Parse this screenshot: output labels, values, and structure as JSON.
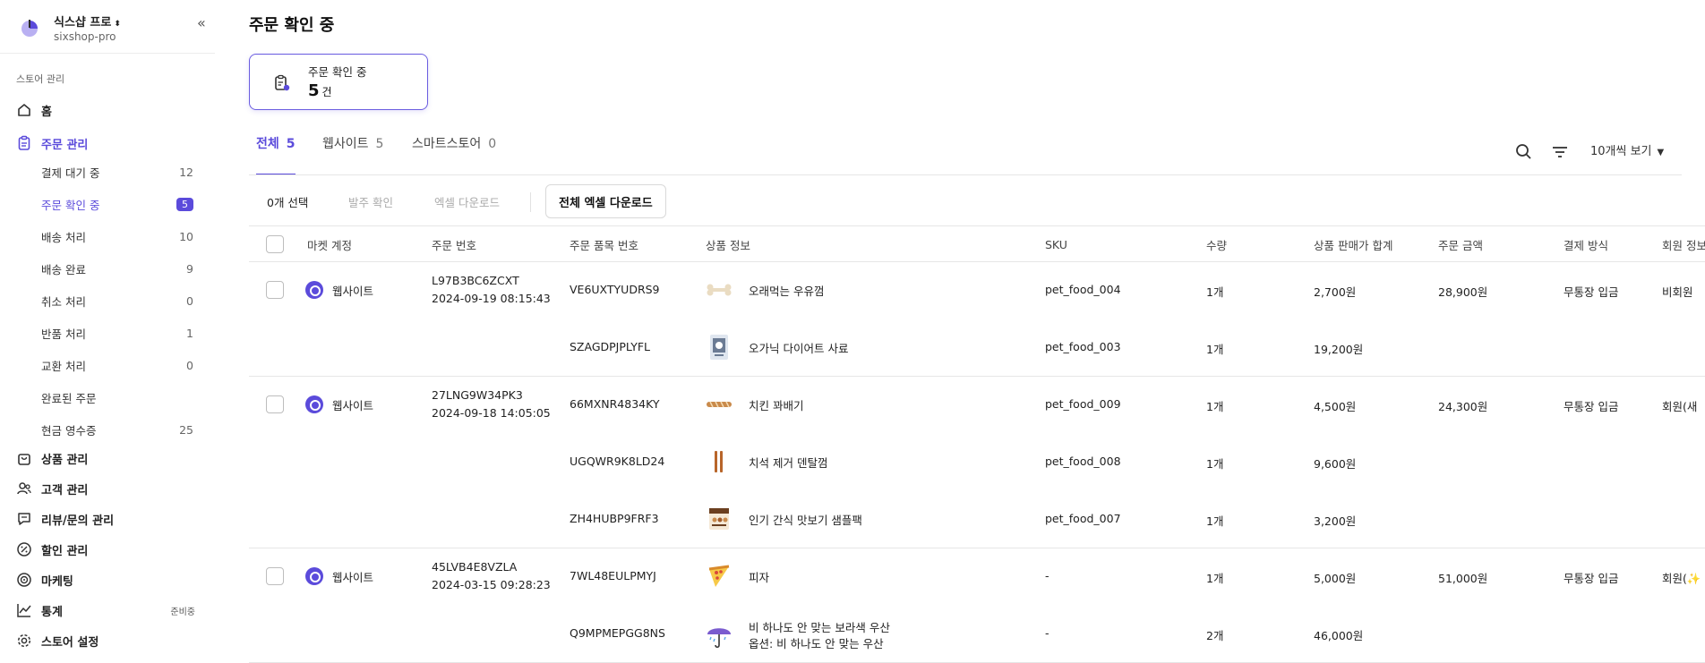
{
  "sidebar": {
    "store_name": "식스샵 프로",
    "store_id": "sixshop-pro",
    "section_title": "스토어 관리",
    "nav": {
      "home": "홈",
      "orders": "주문 관리",
      "products": "상품 관리",
      "customers": "고객 관리",
      "reviews": "리뷰/문의 관리",
      "discounts": "할인 관리",
      "marketing": "마케팅",
      "stats": "통계",
      "stats_badge": "준비중",
      "settings": "스토어 설정"
    },
    "order_sub": [
      {
        "label": "결제 대기 중",
        "count": "12"
      },
      {
        "label": "주문 확인 중",
        "count": "5"
      },
      {
        "label": "배송 처리",
        "count": "10"
      },
      {
        "label": "배송 완료",
        "count": "9"
      },
      {
        "label": "취소 처리",
        "count": "0"
      },
      {
        "label": "반품 처리",
        "count": "1"
      },
      {
        "label": "교환 처리",
        "count": "0"
      },
      {
        "label": "완료된 주문",
        "count": ""
      },
      {
        "label": "현금 영수증",
        "count": "25"
      }
    ]
  },
  "main": {
    "title": "주문 확인 중",
    "summary": {
      "label": "주문 확인 중",
      "value": "5",
      "unit": "건"
    },
    "tabs": [
      {
        "label": "전체",
        "count": "5"
      },
      {
        "label": "웹사이트",
        "count": "5"
      },
      {
        "label": "스마트스토어",
        "count": "0"
      }
    ],
    "view_select": "10개씩 보기",
    "actions": {
      "selected": "0개 선택",
      "confirm": "발주 확인",
      "excel": "엑셀 다운로드",
      "excel_all": "전체 엑셀 다운로드"
    },
    "columns": {
      "market": "마켓 계정",
      "order_no": "주문 번호",
      "item_no": "주문 품목 번호",
      "product": "상품 정보",
      "sku": "SKU",
      "qty": "수량",
      "subtotal": "상품 판매가 합계",
      "amount": "주문 금액",
      "payment": "결제 방식",
      "member": "회원 정보"
    },
    "orders": [
      {
        "market": "웹사이트",
        "order_no": "L97B3BC6ZCXT",
        "date": "2024-09-19 08:15:43",
        "amount": "28,900원",
        "payment": "무통장 입금",
        "member": "비회원",
        "items": [
          {
            "item_no": "VE6UXTYUDRS9",
            "name": "오래먹는 우유껌",
            "sku": "pet_food_004",
            "qty": "1개",
            "subtotal": "2,700원",
            "thumb": "bone-icon"
          },
          {
            "item_no": "SZAGDPJPLYFL",
            "name": "오가닉 다이어트 사료",
            "sku": "pet_food_003",
            "qty": "1개",
            "subtotal": "19,200원",
            "thumb": "food-bag-icon"
          }
        ]
      },
      {
        "market": "웹사이트",
        "order_no": "27LNG9W34PK3",
        "date": "2024-09-18 14:05:05",
        "amount": "24,300원",
        "payment": "무통장 입금",
        "member": "회원(새",
        "items": [
          {
            "item_no": "66MXNR4834KY",
            "name": "치킨 꽈배기",
            "sku": "pet_food_009",
            "qty": "1개",
            "subtotal": "4,500원",
            "thumb": "twist-snack-icon"
          },
          {
            "item_no": "UGQWR9K8LD24",
            "name": "치석 제거 덴탈껌",
            "sku": "pet_food_008",
            "qty": "1개",
            "subtotal": "9,600원",
            "thumb": "dental-stick-icon"
          },
          {
            "item_no": "ZH4HUBP9FRF3",
            "name": "인기 간식 맛보기 샘플팩",
            "sku": "pet_food_007",
            "qty": "1개",
            "subtotal": "3,200원",
            "thumb": "sample-pack-icon"
          }
        ]
      },
      {
        "market": "웹사이트",
        "order_no": "45LVB4E8VZLA",
        "date": "2024-03-15 09:28:23",
        "amount": "51,000원",
        "payment": "무통장 입금",
        "member": "회원(✨",
        "items": [
          {
            "item_no": "7WL48EULPMYJ",
            "name": "피자",
            "sku": "-",
            "qty": "1개",
            "subtotal": "5,000원",
            "thumb": "pizza-icon"
          },
          {
            "item_no": "Q9MPMEPGG8NS",
            "name": "비 하나도 안 맞는 보라색 우산",
            "option": "옵션: 비 하나도 안 맞는 우산",
            "sku": "-",
            "qty": "2개",
            "subtotal": "46,000원",
            "thumb": "umbrella-icon"
          }
        ]
      }
    ]
  }
}
